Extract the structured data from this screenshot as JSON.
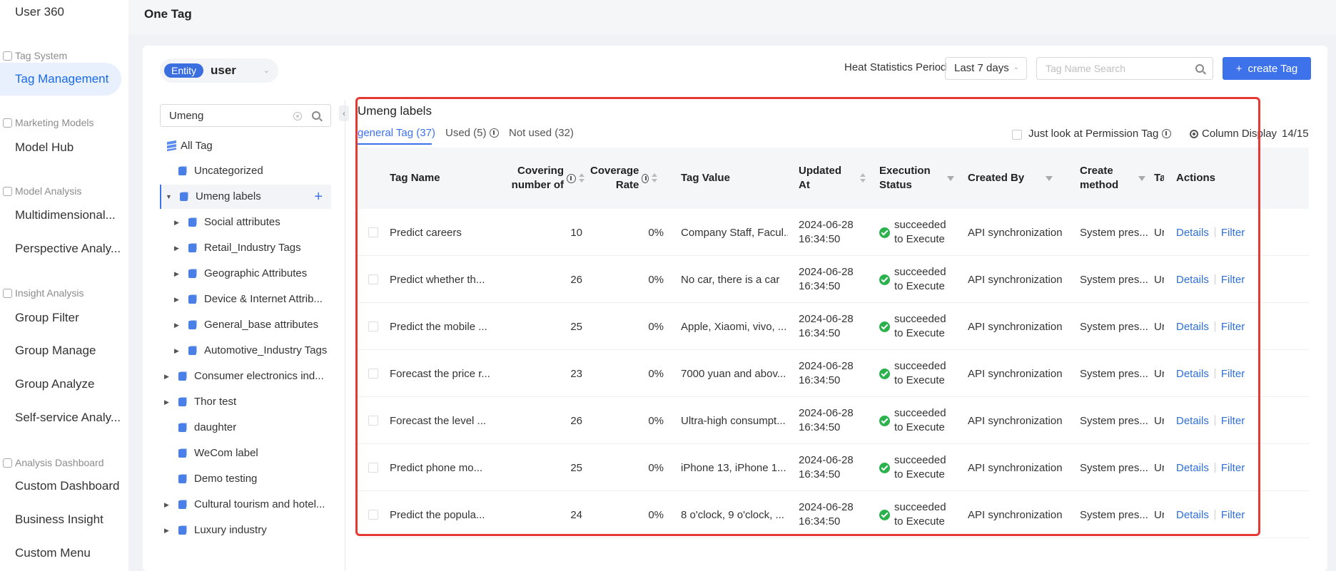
{
  "nav": {
    "items": [
      {
        "type": "item",
        "label": "User 360"
      },
      {
        "type": "group",
        "label": "Tag System"
      },
      {
        "type": "item",
        "label": "Tag Management",
        "active": true
      },
      {
        "type": "group",
        "label": "Marketing Models"
      },
      {
        "type": "item",
        "label": "Model Hub"
      },
      {
        "type": "group",
        "label": "Model Analysis"
      },
      {
        "type": "item",
        "label": "Multidimensional..."
      },
      {
        "type": "item",
        "label": "Perspective Analy..."
      },
      {
        "type": "group",
        "label": "Insight Analysis"
      },
      {
        "type": "item",
        "label": "Group Filter"
      },
      {
        "type": "item",
        "label": "Group Manage"
      },
      {
        "type": "item",
        "label": "Group Analyze"
      },
      {
        "type": "item",
        "label": "Self-service Analy..."
      },
      {
        "type": "group",
        "label": "Analysis Dashboard"
      },
      {
        "type": "item",
        "label": "Custom Dashboard"
      },
      {
        "type": "item",
        "label": "Business Insight"
      },
      {
        "type": "item",
        "label": "Custom Menu"
      }
    ]
  },
  "header": {
    "title": "One Tag"
  },
  "entity": {
    "tag": "Entity",
    "value": "user"
  },
  "toolbar": {
    "heat_label": "Heat Statistics Period",
    "period": "Last 7 days",
    "search_placeholder": "Tag Name Search",
    "create_label": "create Tag"
  },
  "tree": {
    "search_value": "Umeng",
    "all_tag": "All Tag",
    "nodes": [
      {
        "label": "Uncategorized",
        "level": 0,
        "caret": ""
      },
      {
        "label": "Umeng labels",
        "level": 0,
        "caret": "open",
        "selected": true
      },
      {
        "label": "Social attributes",
        "level": 1,
        "caret": "closed"
      },
      {
        "label": "Retail_Industry Tags",
        "level": 1,
        "caret": "closed"
      },
      {
        "label": "Geographic Attributes",
        "level": 1,
        "caret": "closed"
      },
      {
        "label": "Device & Internet Attrib...",
        "level": 1,
        "caret": "closed"
      },
      {
        "label": "General_base attributes",
        "level": 1,
        "caret": "closed"
      },
      {
        "label": "Automotive_Industry Tags",
        "level": 1,
        "caret": "closed"
      },
      {
        "label": "Consumer electronics ind...",
        "level": 0,
        "caret": "closed"
      },
      {
        "label": "Thor test",
        "level": 0,
        "caret": "closed"
      },
      {
        "label": "daughter",
        "level": 0,
        "caret": ""
      },
      {
        "label": "WeCom label",
        "level": 0,
        "caret": ""
      },
      {
        "label": "Demo testing",
        "level": 0,
        "caret": ""
      },
      {
        "label": "Cultural tourism and hotel...",
        "level": 0,
        "caret": "closed"
      },
      {
        "label": "Luxury industry",
        "level": 0,
        "caret": "closed"
      }
    ]
  },
  "content": {
    "title": "Umeng labels",
    "tabs": [
      {
        "label": "general Tag (37)",
        "active": true
      },
      {
        "label": "Used (5)",
        "info": true
      },
      {
        "label": "Not used (32)"
      }
    ],
    "permission_label": "Just look at Permission Tag",
    "column_display": "Column Display",
    "column_count": "14/15"
  },
  "table": {
    "headers": {
      "name": "Tag Name",
      "covering": "Covering number of",
      "rate": "Coverage Rate",
      "value": "Tag Value",
      "updated": "Updated At",
      "status": "Execution Status",
      "created_by": "Created By",
      "method": "Create method",
      "extra": "Ta",
      "actions": "Actions"
    },
    "rows": [
      {
        "name": "Predict careers",
        "covering": "10",
        "rate": "0%",
        "value": "Company Staff, Facul...",
        "date": "2024-06-28",
        "time": "16:34:50",
        "status1": "succeeded",
        "status2": "to Execute",
        "created_by": "API synchronization",
        "method": "System pres...",
        "extra": "Ur",
        "details": "Details",
        "filter": "Filter"
      },
      {
        "name": "Predict whether th...",
        "covering": "26",
        "rate": "0%",
        "value": "No car, there is a car",
        "date": "2024-06-28",
        "time": "16:34:50",
        "status1": "succeeded",
        "status2": "to Execute",
        "created_by": "API synchronization",
        "method": "System pres...",
        "extra": "Ur",
        "details": "Details",
        "filter": "Filter"
      },
      {
        "name": "Predict the mobile ...",
        "covering": "25",
        "rate": "0%",
        "value": "Apple, Xiaomi, vivo, ...",
        "date": "2024-06-28",
        "time": "16:34:50",
        "status1": "succeeded",
        "status2": "to Execute",
        "created_by": "API synchronization",
        "method": "System pres...",
        "extra": "Ur",
        "details": "Details",
        "filter": "Filter"
      },
      {
        "name": "Forecast the price r...",
        "covering": "23",
        "rate": "0%",
        "value": "7000 yuan and abov...",
        "date": "2024-06-28",
        "time": "16:34:50",
        "status1": "succeeded",
        "status2": "to Execute",
        "created_by": "API synchronization",
        "method": "System pres...",
        "extra": "Ur",
        "details": "Details",
        "filter": "Filter"
      },
      {
        "name": "Forecast the level ...",
        "covering": "26",
        "rate": "0%",
        "value": "Ultra-high consumpt...",
        "date": "2024-06-28",
        "time": "16:34:50",
        "status1": "succeeded",
        "status2": "to Execute",
        "created_by": "API synchronization",
        "method": "System pres...",
        "extra": "Ur",
        "details": "Details",
        "filter": "Filter"
      },
      {
        "name": "Predict phone mo...",
        "covering": "25",
        "rate": "0%",
        "value": "iPhone 13, iPhone 1...",
        "date": "2024-06-28",
        "time": "16:34:50",
        "status1": "succeeded",
        "status2": "to Execute",
        "created_by": "API synchronization",
        "method": "System pres...",
        "extra": "Ur",
        "details": "Details",
        "filter": "Filter"
      },
      {
        "name": "Predict the popula...",
        "covering": "24",
        "rate": "0%",
        "value": "8 o'clock, 9 o'clock, ...",
        "date": "2024-06-28",
        "time": "16:34:50",
        "status1": "succeeded",
        "status2": "to Execute",
        "created_by": "API synchronization",
        "method": "System pres...",
        "extra": "Ur",
        "details": "Details",
        "filter": "Filter"
      }
    ]
  },
  "colors": {
    "accent": "#3d72eb",
    "success": "#2bb24c",
    "highlight": "#e53a33"
  }
}
